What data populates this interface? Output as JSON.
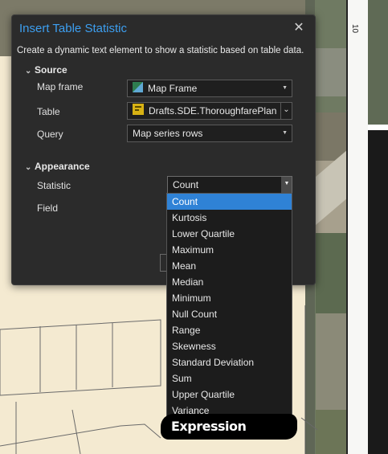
{
  "dialog": {
    "title": "Insert Table Statistic",
    "description": "Create a dynamic text element to show a statistic based on table data.",
    "close_icon": "close-icon"
  },
  "source": {
    "header": "Source",
    "map_frame_label": "Map frame",
    "map_frame_value": "Map Frame",
    "table_label": "Table",
    "table_value": "Drafts.SDE.ThoroughfarePlan",
    "query_label": "Query",
    "query_value": "Map series rows"
  },
  "appearance": {
    "header": "Appearance",
    "statistic_label": "Statistic",
    "statistic_value": "Count",
    "field_label": "Field"
  },
  "dropdown": {
    "items": [
      "Count",
      "Kurtosis",
      "Lower Quartile",
      "Maximum",
      "Mean",
      "Median",
      "Minimum",
      "Null Count",
      "Range",
      "Skewness",
      "Standard Deviation",
      "Sum",
      "Upper Quartile",
      "Variance"
    ],
    "selected": "Count"
  },
  "overlay_text": "Expression",
  "ruler_label": "10"
}
